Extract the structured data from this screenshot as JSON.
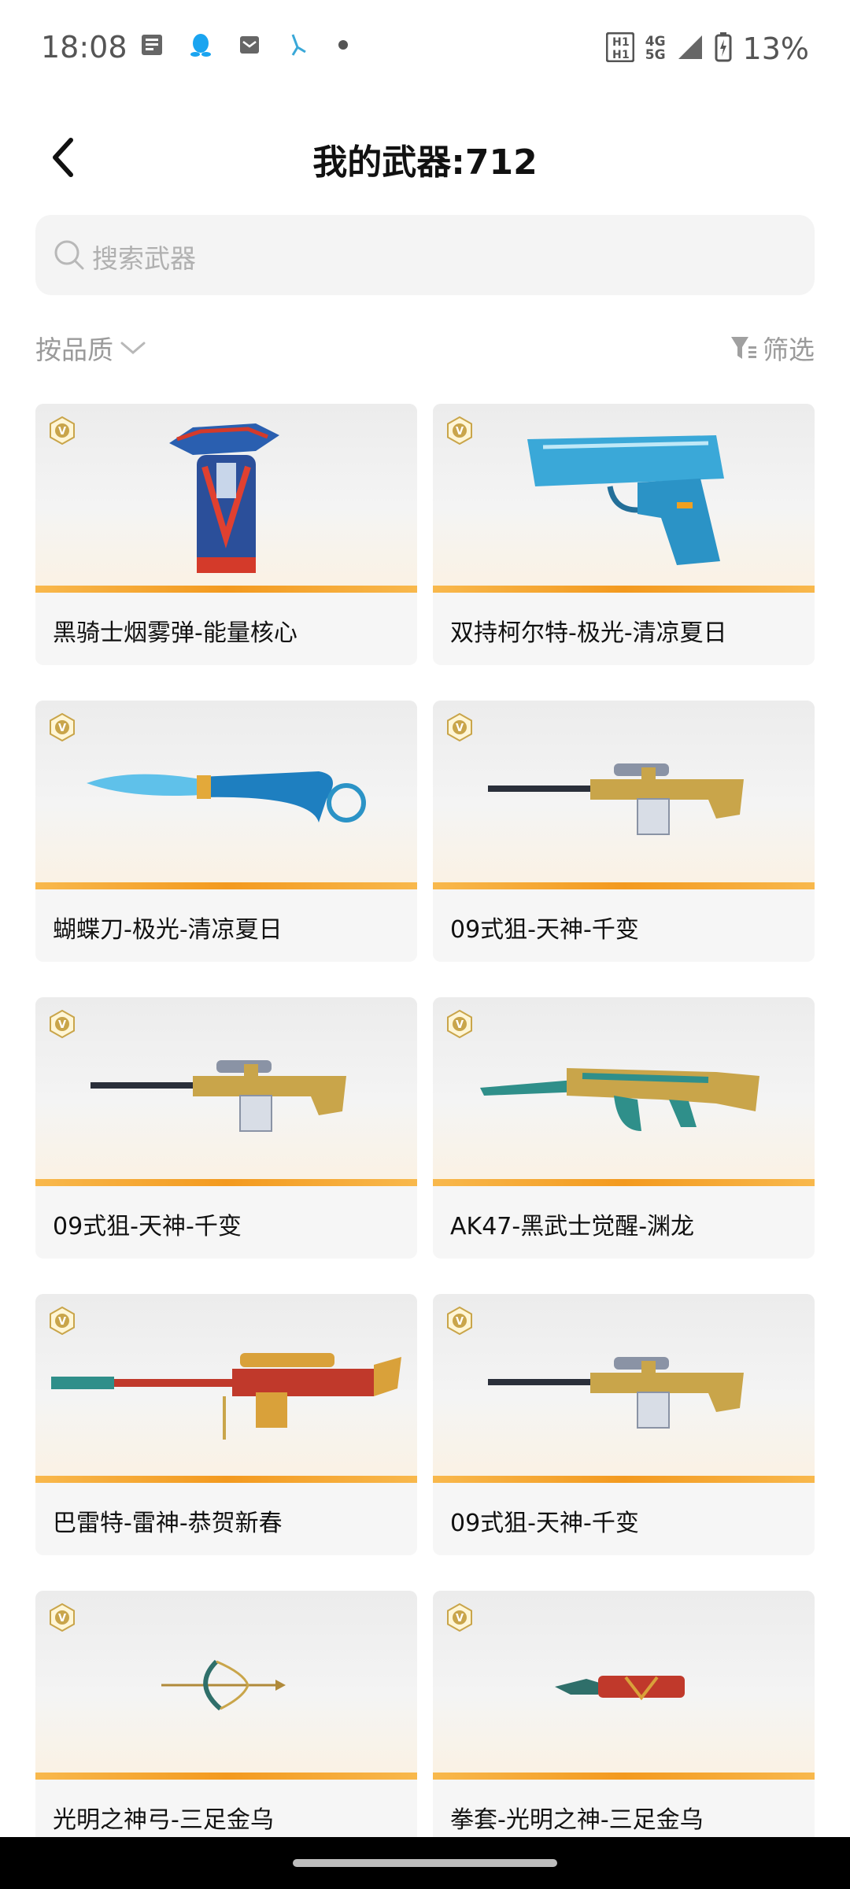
{
  "status_bar": {
    "time": "18:08",
    "net_top": "4G",
    "net_bottom": "5G",
    "battery": "13%"
  },
  "header": {
    "title": "我的武器:712"
  },
  "search": {
    "placeholder": "搜索武器"
  },
  "toolbar": {
    "sort_label": "按品质",
    "filter_label": "筛选"
  },
  "colors": {
    "accent_orange": "#f39a1f",
    "card_bg": "#f6f6f6",
    "badge_gold": "#c9a54a"
  },
  "weapons": [
    {
      "name": "黑骑士烟雾弹-能量核心",
      "icon": "smoke-grenade-icon"
    },
    {
      "name": "双持柯尔特-极光-清凉夏日",
      "icon": "pistol-icon"
    },
    {
      "name": "蝴蝶刀-极光-清凉夏日",
      "icon": "butterfly-knife-icon"
    },
    {
      "name": "09式狙-天神-千变",
      "icon": "sniper-rifle-icon"
    },
    {
      "name": "09式狙-天神-千变",
      "icon": "sniper-rifle-icon"
    },
    {
      "name": "AK47-黑武士觉醒-渊龙",
      "icon": "assault-rifle-icon"
    },
    {
      "name": "巴雷特-雷神-恭贺新春",
      "icon": "barrett-rifle-icon"
    },
    {
      "name": "09式狙-天神-千变",
      "icon": "sniper-rifle-icon"
    },
    {
      "name": "光明之神弓-三足金乌",
      "icon": "bow-icon"
    },
    {
      "name": "拳套-光明之神-三足金乌",
      "icon": "gauntlet-icon"
    }
  ]
}
